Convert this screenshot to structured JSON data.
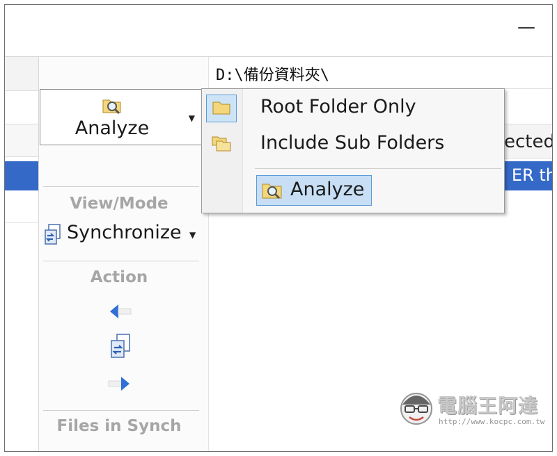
{
  "window": {
    "minimize_glyph": "—"
  },
  "path_field": {
    "value": "D:\\備份資料夾\\"
  },
  "toolbar": {
    "analyze": {
      "label": "Analyze",
      "icon": "folder-magnifier-icon",
      "dropdown_icon": "caret-down-icon"
    },
    "view_mode": {
      "group_label": "View/Mode",
      "value": "Synchronize",
      "icon": "synchronize-icon"
    },
    "action": {
      "group_label": "Action",
      "buttons": [
        {
          "name": "copy-left",
          "icon": "arrow-left-icon"
        },
        {
          "name": "synchronize",
          "icon": "sync-files-icon"
        },
        {
          "name": "copy-right",
          "icon": "arrow-right-icon"
        }
      ]
    },
    "files_in_synch": {
      "group_label": "Files in Synch"
    }
  },
  "grid": {
    "column_header_fragment": "ected",
    "selected_row_fragment": "ER th"
  },
  "dropdown_menu": {
    "items": [
      {
        "label": "Root Folder Only",
        "icon": "folder-icon",
        "checked": true
      },
      {
        "label": "Include Sub Folders",
        "icon": "folders-icon",
        "checked": false
      }
    ],
    "action": {
      "label": "Analyze",
      "icon": "folder-magnifier-icon"
    }
  },
  "watermark": {
    "name": "電腦王阿達",
    "url": "http://www.kocpc.com.tw"
  },
  "colors": {
    "selection_blue": "#3569c8",
    "highlight_border": "#5b9ad9",
    "highlight_fill": "#c7def5",
    "group_label_gray": "#a6a6a6"
  }
}
